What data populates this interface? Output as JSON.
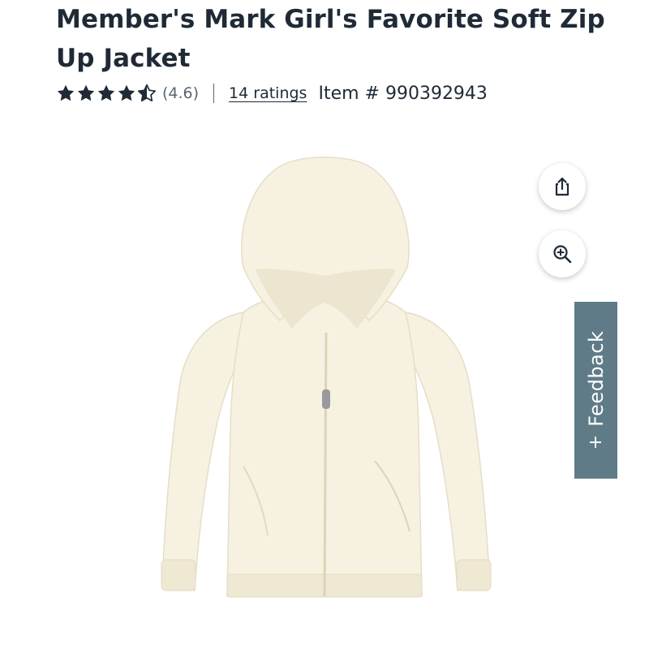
{
  "product": {
    "title": "Member's Mark Girl's Favorite Soft Zip Up Jacket",
    "rating_value": "(4.6)",
    "rating": 4.6,
    "ratings_count_label": "14 ratings",
    "item_number": "Item # 990392943"
  },
  "image": {
    "subject": "cream zip-up hooded jacket",
    "fill_color": "#f6f1e0",
    "shade_color": "#e9e2cb"
  },
  "actions": {
    "share_icon": "share-icon",
    "zoom_icon": "zoom-in-icon"
  },
  "feedback": {
    "plus": "+",
    "label": "Feedback",
    "color": "#5f7b88"
  },
  "colors": {
    "text": "#1f2a36",
    "muted": "#5b6570",
    "star": "#1f2a36"
  }
}
